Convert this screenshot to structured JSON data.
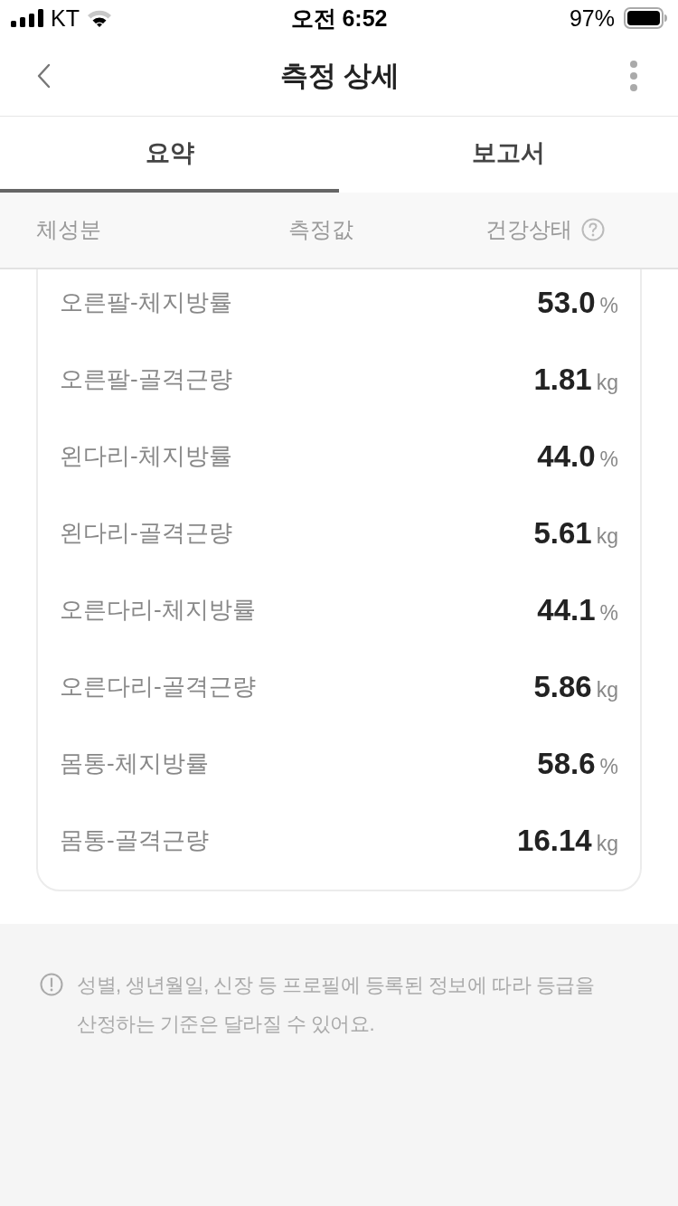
{
  "status_bar": {
    "carrier": "KT",
    "time": "오전 6:52",
    "battery": "97%"
  },
  "header": {
    "title": "측정 상세"
  },
  "tabs": [
    {
      "label": "요약",
      "selected": true
    },
    {
      "label": "보고서",
      "selected": false
    }
  ],
  "columns": [
    {
      "label": "체성분",
      "help": false
    },
    {
      "label": "측정값",
      "help": false
    },
    {
      "label": "건강상태",
      "help": true
    }
  ],
  "rows": [
    {
      "name": "오른팔-체지방률",
      "value": "53.0",
      "unit": "%"
    },
    {
      "name": "오른팔-골격근량",
      "value": "1.81",
      "unit": "kg"
    },
    {
      "name": "왼다리-체지방률",
      "value": "44.0",
      "unit": "%"
    },
    {
      "name": "왼다리-골격근량",
      "value": "5.61",
      "unit": "kg"
    },
    {
      "name": "오른다리-체지방률",
      "value": "44.1",
      "unit": "%"
    },
    {
      "name": "오른다리-골격근량",
      "value": "5.86",
      "unit": "kg"
    },
    {
      "name": "몸통-체지방률",
      "value": "58.6",
      "unit": "%"
    },
    {
      "name": "몸통-골격근량",
      "value": "16.14",
      "unit": "kg"
    }
  ],
  "notice": "성별, 생년월일, 신장 등 프로필에 등록된 정보에 따라 등급을 산정하는 기준은 달라질 수 있어요."
}
